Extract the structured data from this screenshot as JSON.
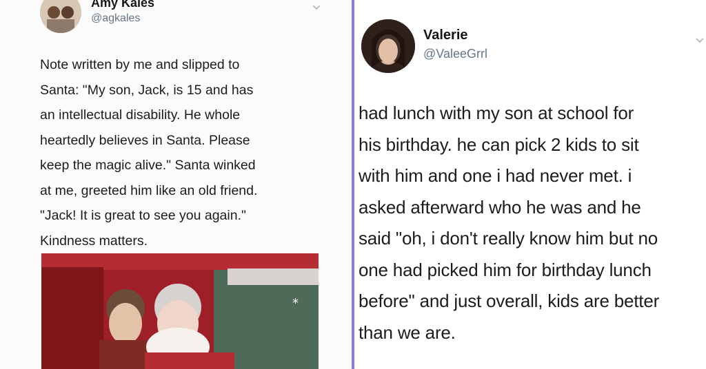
{
  "left_tweet": {
    "name": "Amy Kales",
    "handle": "@agkales",
    "text": "Note written by me and slipped to Santa: \"My son, Jack, is 15 and has an intellectual disability. He whole heartedly believes in Santa. Please keep the magic alive.\" Santa winked at me, greeted him like an old friend. \"Jack! It is great to see you again.\" Kindness matters.",
    "lines": [
      "Note written by me and slipped to",
      "Santa: \"My son, Jack, is 15 and has",
      "an intellectual disability. He whole",
      "heartedly believes in Santa. Please",
      "keep the magic alive.\" Santa winked",
      "at me, greeted him like an old friend.",
      "\"Jack! It is great to see you again.\"",
      "Kindness matters."
    ],
    "avatar_icon": "profile-photo-icon",
    "menu_icon": "chevron-down-icon"
  },
  "right_tweet": {
    "name": "Valerie",
    "handle": "@ValeeGrrl",
    "lines": [
      "had lunch with my son at school for",
      "his birthday. he can pick 2 kids to sit",
      "with him and one i had never met. i",
      "asked afterward who he was and he",
      "said \"oh, i don't really know him but no",
      "one had picked him for birthday lunch",
      "before\" and just overall, kids are better",
      "than we are."
    ],
    "avatar_icon": "profile-photo-icon",
    "menu_icon": "chevron-down-icon"
  },
  "colors": {
    "divider": "#8f7bd8",
    "name": "#14171a",
    "handle": "#657786",
    "text": "#1c1c1c"
  }
}
